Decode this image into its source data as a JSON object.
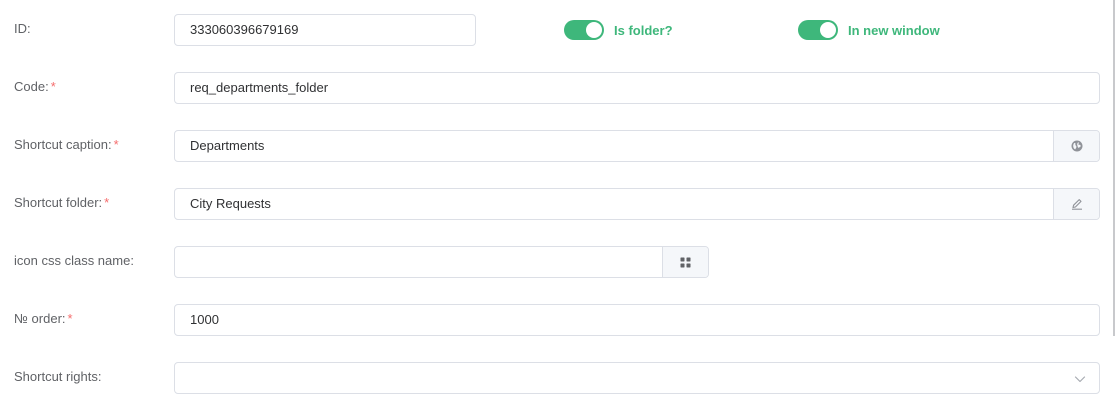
{
  "colors": {
    "accent": "#3eb77b",
    "required": "#f56c6c",
    "label": "#606266",
    "border": "#dcdfe6"
  },
  "fields": {
    "id": {
      "label": "ID:",
      "value": "333060396679169"
    },
    "is_folder": {
      "label": "Is folder?",
      "checked": true
    },
    "in_new_window": {
      "label": "In new window",
      "checked": true
    },
    "code": {
      "label": "Code:",
      "required_mark": "*",
      "value": "req_departments_folder"
    },
    "shortcut_caption": {
      "label": "Shortcut caption:",
      "required_mark": "*",
      "value": "Departments",
      "icon": "globe-icon"
    },
    "shortcut_folder": {
      "label": "Shortcut folder:",
      "required_mark": "*",
      "value": "City Requests",
      "icon": "edit-icon"
    },
    "icon_css": {
      "label": "icon css class name:",
      "value": "",
      "icon": "grid-icon"
    },
    "order": {
      "label": "№ order:",
      "required_mark": "*",
      "value": "1000"
    },
    "shortcut_rights": {
      "label": "Shortcut rights:",
      "value": "",
      "icon": "chevron-down-icon"
    }
  }
}
